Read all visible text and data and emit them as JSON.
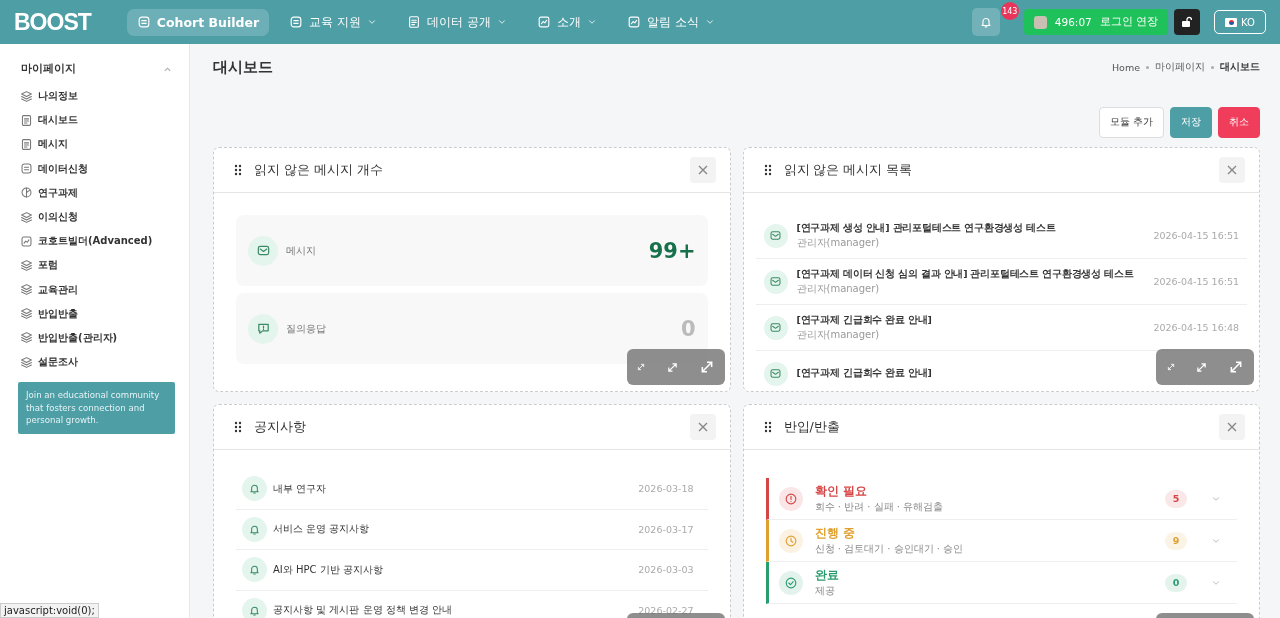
{
  "header": {
    "logo": "BOOST",
    "nav": [
      {
        "label": "Cohort Builder",
        "kind": "pill",
        "selected": true
      },
      {
        "label": "교육 지원",
        "kind": "menu",
        "selected": false
      },
      {
        "label": "데이터 공개",
        "kind": "menu",
        "selected": false
      },
      {
        "label": "소개",
        "kind": "menu",
        "selected": false
      },
      {
        "label": "알림 소식",
        "kind": "menu",
        "selected": false
      }
    ],
    "notification_count": "143",
    "session_timer": "496:07",
    "session_action": "로그인 연장",
    "language": "KO"
  },
  "sidebar": {
    "section": "마이페이지",
    "expanded": true,
    "items": [
      {
        "label": "나의정보",
        "kind": "layers"
      },
      {
        "label": "대시보드",
        "kind": "doc"
      },
      {
        "label": "메시지",
        "kind": "doc"
      },
      {
        "label": "데이터신청",
        "kind": "form"
      },
      {
        "label": "연구과제",
        "kind": "pie"
      },
      {
        "label": "이의신청",
        "kind": "layers"
      },
      {
        "label": "코호트빌더(Advanced)",
        "kind": "chart"
      },
      {
        "label": "포럼",
        "kind": "layers"
      },
      {
        "label": "교육관리",
        "kind": "layers"
      },
      {
        "label": "반입반출",
        "kind": "layers"
      },
      {
        "label": "반입반출(관리자)",
        "kind": "layers"
      },
      {
        "label": "설문조사",
        "kind": "layers"
      }
    ],
    "note": "Join an educational community that fosters connection and personal growth."
  },
  "page": {
    "title": "대시보드",
    "breadcrumb": [
      "Home",
      "마이페이지",
      "대시보드"
    ],
    "buttons": [
      {
        "label": "모듈 추가",
        "kind": "default"
      },
      {
        "label": "저장",
        "kind": "primary"
      },
      {
        "label": "취소",
        "kind": "danger"
      }
    ]
  },
  "widgets": [
    {
      "kind": "counts",
      "title": "읽지 않은 메시지 개수",
      "items": [
        {
          "label": "메시지",
          "value": "99+",
          "highlight": true,
          "kind": "mail"
        },
        {
          "label": "질의응답",
          "value": "0",
          "highlight": false,
          "kind": "chat"
        }
      ]
    },
    {
      "kind": "messages",
      "title": "읽지 않은 메시지 목록",
      "items": [
        {
          "title": "[연구과제 생성 안내] 관리포털테스트 연구환경생성 테스트",
          "sender": "관리자(manager)",
          "time": "2026-04-15 16:51"
        },
        {
          "title": "[연구과제 데이터 신청 심의 결과 안내] 관리포털테스트 연구환경생성 테스트",
          "sender": "관리자(manager)",
          "time": "2026-04-15 16:51"
        },
        {
          "title": "[연구과제 긴급회수 완료 안내]",
          "sender": "관리자(manager)",
          "time": "2026-04-15 16:48"
        },
        {
          "title": "[연구과제 긴급회수 완료 안내]"
        }
      ]
    },
    {
      "kind": "notices",
      "title": "공지사항",
      "items": [
        {
          "title": "내부 연구자",
          "date": "2026-03-18"
        },
        {
          "title": "서비스 운영 공지사항",
          "date": "2026-03-17"
        },
        {
          "title": "AI와 HPC 기반 공지사항",
          "date": "2026-03-03"
        },
        {
          "title": "공지사항 및 게시판 운영 정책 변경 안내",
          "date": "2026-02-27"
        }
      ]
    },
    {
      "kind": "transfer",
      "title": "반입/반출",
      "items": [
        {
          "title": "확인 필요",
          "detail": "회수 · 반려 · 실패 · 유해검출",
          "count": "5",
          "color": "#d64545",
          "kind": "alert"
        },
        {
          "title": "진행 중",
          "detail": "신청 · 검토대기 · 승인대기 · 승인",
          "count": "9",
          "color": "#e0a030",
          "kind": "clock"
        },
        {
          "title": "완료",
          "detail": "제공",
          "count": "0",
          "color": "#2a9d6f",
          "kind": "check"
        }
      ]
    }
  ],
  "status_text": "javascript:void(0);"
}
